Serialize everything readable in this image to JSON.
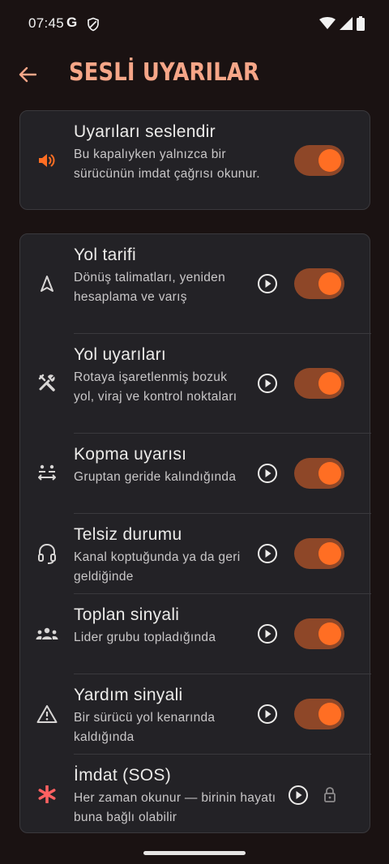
{
  "status_bar": {
    "time": "07:45",
    "g_letter": "G",
    "icons": [
      "google-icon",
      "shield-icon",
      "wifi-icon",
      "signal-icon",
      "battery-icon"
    ]
  },
  "header": {
    "title": "SESLİ UYARILAR",
    "back_icon": "arrow-left-icon"
  },
  "colors": {
    "accent": "#ff6e23",
    "toggle_track": "#8e4728",
    "title": "#f6a688",
    "sos": "#ff6161",
    "card_bg": "#232226",
    "page_bg": "#1a1212"
  },
  "master": {
    "icon": "speaker-icon",
    "title": "Uyarıları seslendir",
    "description": "Bu kapalıyken yalnızca bir sürücünün imdat çağrısı okunur.",
    "enabled": true
  },
  "alerts": [
    {
      "icon": "navigation-arrow-icon",
      "title": "Yol tarifi",
      "description": "Dönüş talimatları, yeniden hesaplama ve varış",
      "enabled": true
    },
    {
      "icon": "tools-icon",
      "title": "Yol uyarıları",
      "description": "Rotaya işaretlenmiş bozuk yol, viraj ve kontrol noktaları",
      "enabled": true
    },
    {
      "icon": "separation-icon",
      "title": "Kopma uyarısı",
      "description": "Gruptan geride kalındığında",
      "enabled": true
    },
    {
      "icon": "headset-icon",
      "title": "Telsiz durumu",
      "description": "Kanal koptuğunda ya da geri geldiğinde",
      "enabled": true
    },
    {
      "icon": "group-icon",
      "title": "Toplan sinyali",
      "description": "Lider grubu topladığında",
      "enabled": true
    },
    {
      "icon": "warning-triangle-icon",
      "title": "Yardım sinyali",
      "description": "Bir sürücü yol kenarında kaldığında",
      "enabled": true
    },
    {
      "icon": "asterisk-icon",
      "title": "İmdat (SOS)",
      "description": "Her zaman okunur — birinin hayatı buna bağlı olabilir",
      "locked": true
    }
  ]
}
